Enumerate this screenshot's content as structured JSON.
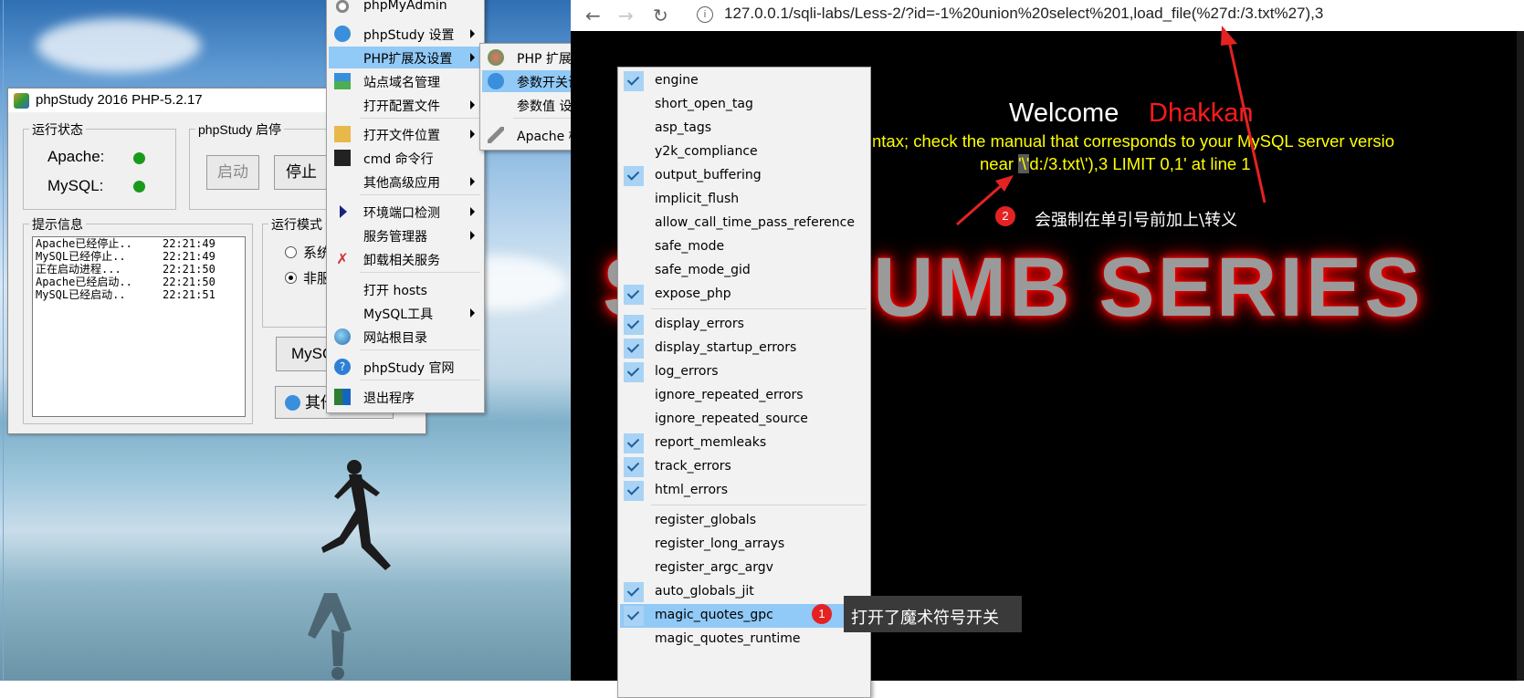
{
  "phpstudy": {
    "title": "phpStudy 2016   PHP-5.2.17",
    "status_group": "运行状态",
    "apache_label": "Apache:",
    "mysql_label": "MySQL:",
    "status_color": "#1a9a1a",
    "control_group": "phpStudy 启停",
    "start_label": "启动",
    "stop_label": "停止",
    "info_group": "提示信息",
    "mode_group": "运行模式",
    "mode_option1": "系统",
    "mode_option2": "非服",
    "mysql_btn": "MySQ",
    "other_btn": "其他",
    "log": [
      {
        "msg": "Apache已经停止..",
        "time": "22:21:49"
      },
      {
        "msg": "MySQL已经停止..",
        "time": "22:21:49"
      },
      {
        "msg": "正在启动进程...",
        "time": "22:21:50"
      },
      {
        "msg": "Apache已经启动..",
        "time": "22:21:50"
      },
      {
        "msg": "MySQL已经启动..",
        "time": "22:21:51"
      }
    ]
  },
  "menu_main": {
    "items": [
      {
        "label": "phpMyAdmin",
        "icon": "phpmyadmin-icon"
      },
      {
        "label": "phpStudy 设置",
        "icon": "gear-icon",
        "submenu": true
      },
      {
        "label": "PHP扩展及设置",
        "icon": "",
        "submenu": true,
        "highlight": true
      },
      {
        "label": "站点域名管理",
        "icon": "sites-icon"
      },
      {
        "label": "打开配置文件",
        "icon": "",
        "submenu": true
      },
      {
        "label": "打开文件位置",
        "icon": "folder-icon",
        "submenu": true
      },
      {
        "label": "cmd 命令行",
        "icon": "terminal-icon"
      },
      {
        "label": "其他高级应用",
        "icon": "",
        "submenu": true
      },
      {
        "label": "环境端口检测",
        "icon": "triangle-icon",
        "submenu": true
      },
      {
        "label": "服务管理器",
        "icon": "",
        "submenu": true
      },
      {
        "label": "卸载相关服务",
        "icon": "uninstall-icon"
      },
      {
        "label": "打开 hosts",
        "icon": ""
      },
      {
        "label": "MySQL工具",
        "icon": "",
        "submenu": true
      },
      {
        "label": "网站根目录",
        "icon": "globe-icon"
      },
      {
        "label": "phpStudy 官网",
        "icon": "help-icon"
      },
      {
        "label": "退出程序",
        "icon": "exit-icon"
      }
    ]
  },
  "menu_php": {
    "items": [
      {
        "label": "PHP 扩展",
        "icon": "puzzle-icon",
        "submenu": true
      },
      {
        "label": "参数开关设置",
        "icon": "gear-icon",
        "submenu": true,
        "highlight": true
      },
      {
        "label": "参数值 设置",
        "icon": "",
        "submenu": true
      },
      {
        "label": "Apache 模块",
        "icon": "feather-icon",
        "submenu": true
      }
    ]
  },
  "menu_params": {
    "items": [
      {
        "label": "engine",
        "checked": true
      },
      {
        "label": "short_open_tag",
        "checked": false
      },
      {
        "label": "asp_tags",
        "checked": false
      },
      {
        "label": "y2k_compliance",
        "checked": false
      },
      {
        "label": "output_buffering",
        "checked": true
      },
      {
        "label": "implicit_flush",
        "checked": false
      },
      {
        "label": "allow_call_time_pass_reference",
        "checked": false
      },
      {
        "label": "safe_mode",
        "checked": false
      },
      {
        "label": "safe_mode_gid",
        "checked": false
      },
      {
        "label": "expose_php",
        "checked": true
      },
      {
        "label": "display_errors",
        "checked": true
      },
      {
        "label": "display_startup_errors",
        "checked": true
      },
      {
        "label": "log_errors",
        "checked": true
      },
      {
        "label": "ignore_repeated_errors",
        "checked": false
      },
      {
        "label": "ignore_repeated_source",
        "checked": false
      },
      {
        "label": "report_memleaks",
        "checked": true
      },
      {
        "label": "track_errors",
        "checked": true
      },
      {
        "label": "html_errors",
        "checked": true
      },
      {
        "label": "register_globals",
        "checked": false
      },
      {
        "label": "register_long_arrays",
        "checked": false
      },
      {
        "label": "register_argc_argv",
        "checked": false
      },
      {
        "label": "auto_globals_jit",
        "checked": true
      },
      {
        "label": "magic_quotes_gpc",
        "checked": true,
        "highlight": true
      },
      {
        "label": "magic_quotes_runtime",
        "checked": false
      }
    ]
  },
  "browser": {
    "url": "127.0.0.1/sqli-labs/Less-2/?id=-1%20union%20select%201,load_file(%27d:/3.txt%27),3",
    "welcome": "Welcome",
    "user": "Dhakkan",
    "user_color": "#ff1a1a",
    "error_line1": "ntax; check the manual that corresponds to your MySQL server versio",
    "error_near": "near ",
    "error_highlight": "'\\'",
    "error_line2_rest": "d:/3.txt\\'),3 LIMIT 0,1' at line 1",
    "error_color": "#ffff00",
    "banner": "SQLIDUMB SERIES",
    "annotation1_badge": "1",
    "annotation1_text": "打开了魔术符号开关",
    "annotation2_badge": "2",
    "annotation2_text": "会强制在单引号前加上\\转义",
    "annotation_color": "#e52222"
  }
}
